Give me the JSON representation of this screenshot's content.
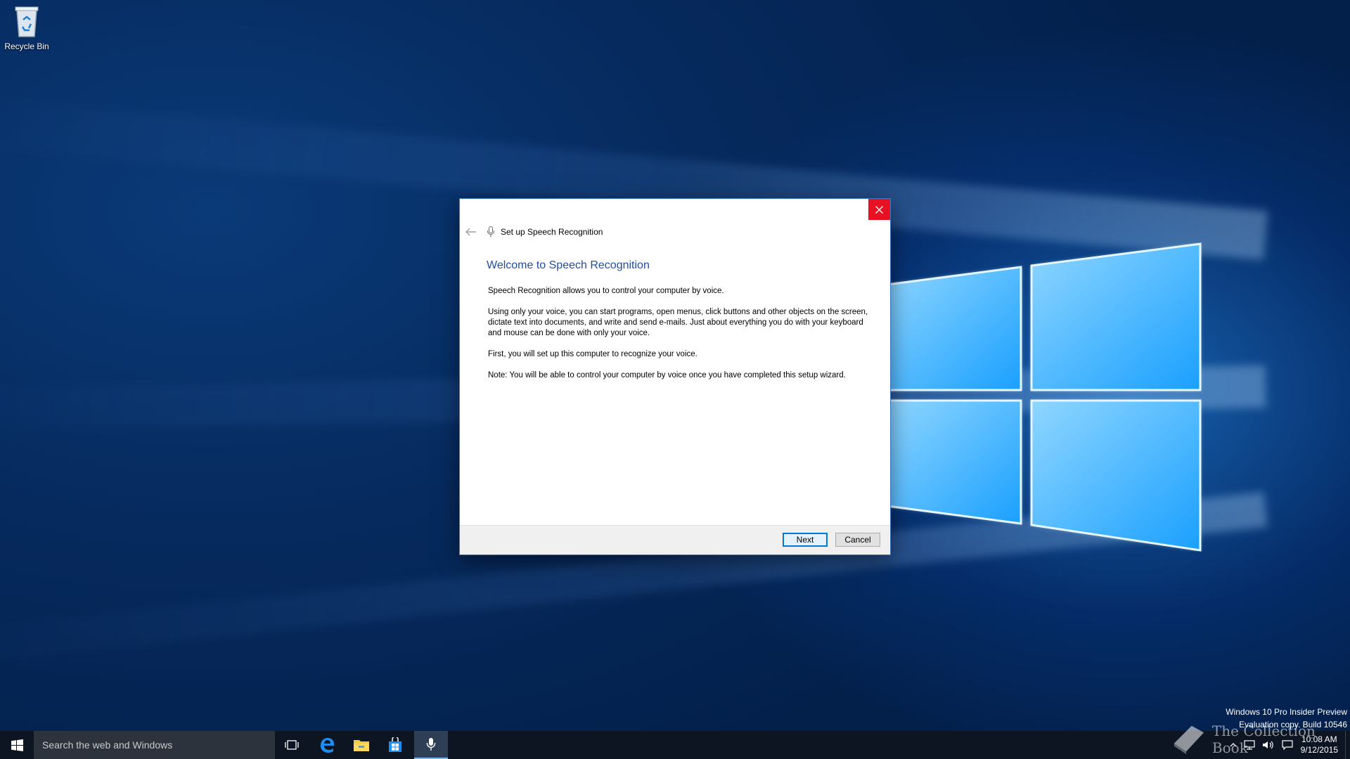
{
  "desktop": {
    "recycle_bin_label": "Recycle Bin"
  },
  "dialog": {
    "header_title": "Set up Speech Recognition",
    "heading": "Welcome to Speech Recognition",
    "paragraphs": [
      "Speech Recognition allows you to control your computer by voice.",
      "Using only your voice, you can start programs, open menus, click buttons and other objects on the screen, dictate text into documents, and write and send e-mails. Just about everything you do with your keyboard and mouse can be done with only your voice.",
      "First, you will set up this computer to recognize your voice.",
      "Note: You will be able to control your computer by voice once you have completed this setup wizard."
    ],
    "next_label": "Next",
    "cancel_label": "Cancel"
  },
  "taskbar": {
    "search_placeholder": "Search the web and Windows",
    "pinned": [
      "task-view-icon",
      "edge-icon",
      "file-explorer-icon",
      "store-icon",
      "microphone-icon"
    ],
    "time": "10:08 AM",
    "date": "9/12/2015"
  },
  "watermark": {
    "line1": "Windows 10 Pro Insider Preview",
    "line2": "Evaluation copy. Build 10546"
  },
  "overlay_text": "The Collection Book",
  "colors": {
    "close_red": "#e81123",
    "heading_blue": "#1f4e9c",
    "accent": "#0078d7",
    "taskbar": "#0d1522"
  }
}
